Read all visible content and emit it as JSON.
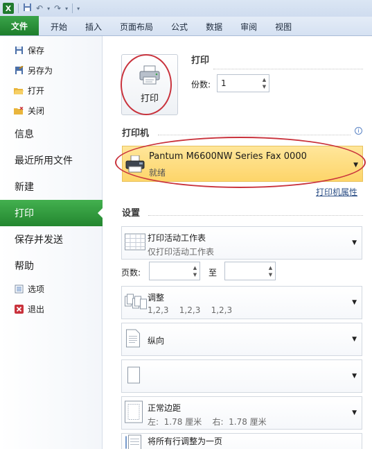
{
  "qat": {
    "app_icon": "X",
    "save_icon": "save-icon",
    "undo_icon": "undo-icon",
    "redo_icon": "redo-icon",
    "customize_icon": "customize-qat-icon"
  },
  "tabs": [
    "文件",
    "开始",
    "插入",
    "页面布局",
    "公式",
    "数据",
    "审阅",
    "视图"
  ],
  "nav": {
    "save": "保存",
    "save_as": "另存为",
    "open": "打开",
    "close": "关闭",
    "info": "信息",
    "recent": "最近所用文件",
    "new": "新建",
    "print": "打印",
    "save_send": "保存并发送",
    "help": "帮助",
    "options": "选项",
    "exit": "退出"
  },
  "print": {
    "section_title": "打印",
    "button_label": "打印",
    "copies_label": "份数:",
    "copies_value": "1"
  },
  "printer": {
    "section_title": "打印机",
    "name": "Pantum M6600NW Series Fax 0000",
    "status": "就绪",
    "properties_link": "打印机属性",
    "info_icon": "i"
  },
  "settings": {
    "section_title": "设置",
    "scope_title": "打印活动工作表",
    "scope_sub": "仅打印活动工作表",
    "pages_label": "页数:",
    "pages_to_label": "至",
    "pages_from": "",
    "pages_to": "",
    "collate_title": "调整",
    "collate_sub": "1,2,3    1,2,3    1,2,3",
    "orientation": "纵向",
    "paper": "",
    "margins_title": "正常边距",
    "margins_sub": "左:  1.78 厘米    右:  1.78 厘米",
    "scaling_title": "将所有行调整为一页"
  },
  "colors": {
    "file_tab": "#1d7d2b",
    "active_nav": "#23862f",
    "printer_highlight": "#fdd56a",
    "annotation": "#c9323c"
  }
}
